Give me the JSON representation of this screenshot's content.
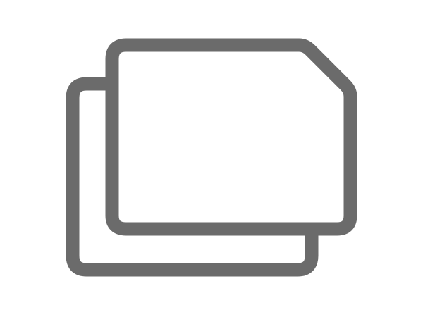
{
  "icon": {
    "name": "stacked-cards-icon",
    "stroke_color": "#6b6b6b",
    "fill_color": "#ffffff",
    "background": "#ffffff"
  }
}
